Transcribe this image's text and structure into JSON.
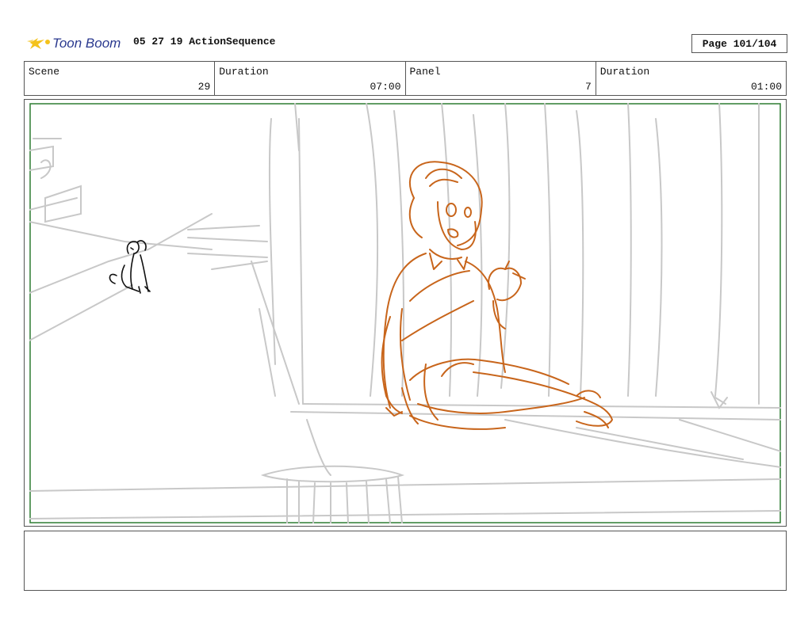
{
  "header": {
    "title": "05 27 19 ActionSequence",
    "page": "Page 101/104",
    "logo_icon": "toon-boom-logo-icon"
  },
  "info": {
    "scene_label": "Scene",
    "scene_value": "29",
    "duration_label": "Duration",
    "duration_value": "07:00",
    "panel_label": "Panel",
    "panel_value": "7",
    "panel_duration_label": "Duration",
    "panel_duration_value": "01:00"
  },
  "notes": {
    "text": ""
  },
  "colors": {
    "frame_green": "#2e7d32",
    "character_orange": "#c8651b",
    "sketch_gray": "#c8c8c8"
  }
}
